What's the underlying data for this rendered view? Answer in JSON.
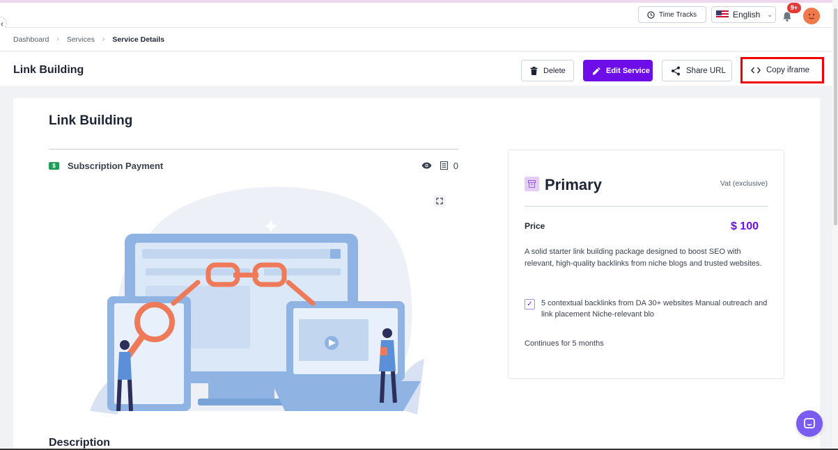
{
  "topbar": {
    "time_tracks_label": "Time Tracks",
    "language_label": "English",
    "notification_count": "9+"
  },
  "breadcrumb": [
    "Dashboard",
    "Services",
    "Service Details"
  ],
  "header": {
    "title": "Link Building",
    "delete_label": "Delete",
    "edit_label": "Edit Service",
    "share_label": "Share URL",
    "copy_label": "Copy iframe"
  },
  "service": {
    "title": "Link Building",
    "payment_type": "Subscription Payment",
    "view_count": "0",
    "description_heading": "Description"
  },
  "plan": {
    "name": "Primary",
    "vat": "Vat (exclusive)",
    "price_label": "Price",
    "price": "$ 100",
    "description": "A solid starter link building package designed to boost SEO with relevant, high-quality backlinks from niche blogs and trusted websites.",
    "feature": "5 contextual backlinks from DA 30+ websites Manual outreach and link placement Niche-relevant blo",
    "duration": "Continues for 5 months"
  },
  "colors": {
    "accent": "#6d0ee8",
    "highlight_border": "#ee0000",
    "badge": "#e53935",
    "chat": "#7b5cf0"
  },
  "icons": [
    "clock-icon",
    "us-flag-icon",
    "chevron-down-icon",
    "bell-icon",
    "avatar",
    "trash-icon",
    "pencil-icon",
    "share-icon",
    "code-icon",
    "dollar-icon",
    "eye-icon",
    "list-icon",
    "expand-icon",
    "plan-icon",
    "check-icon",
    "chat-icon"
  ]
}
